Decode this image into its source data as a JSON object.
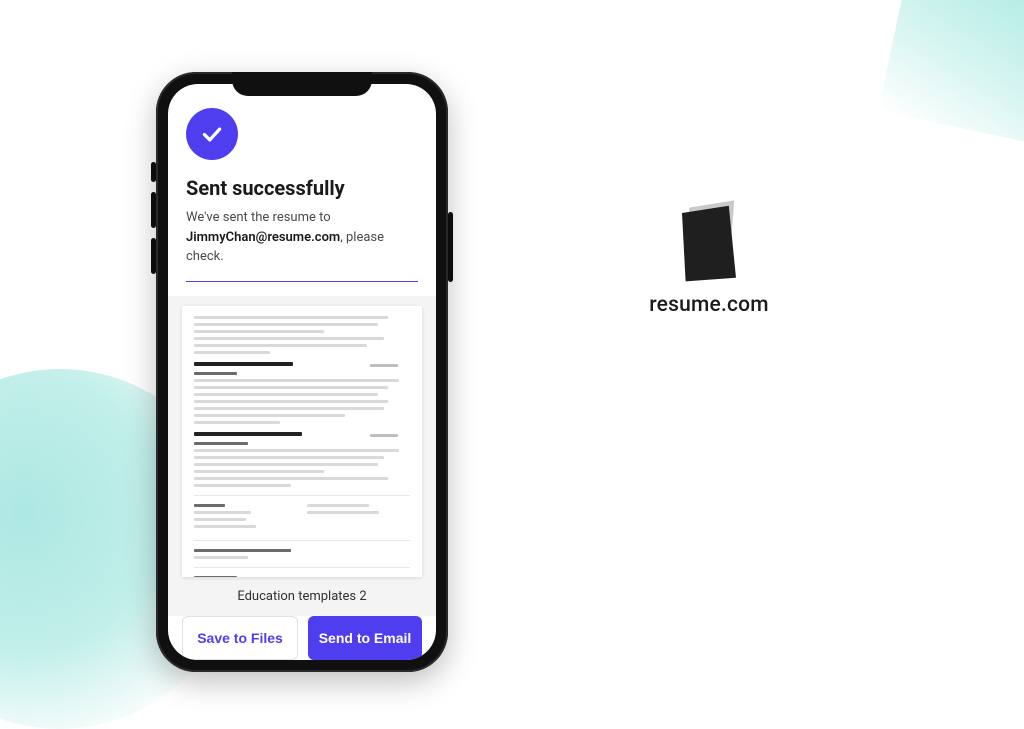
{
  "brand": {
    "name": "resume.com"
  },
  "dialog": {
    "title": "Sent successfully",
    "sent_prefix": "We've sent the resume to",
    "email": "JimmyChan@resume.com",
    "sent_suffix": ", please check."
  },
  "preview": {
    "caption": "Education templates 2"
  },
  "actions": {
    "save_label": "Save to Files",
    "send_label": "Send to Email"
  },
  "colors": {
    "accent": "#4f3ef0"
  }
}
